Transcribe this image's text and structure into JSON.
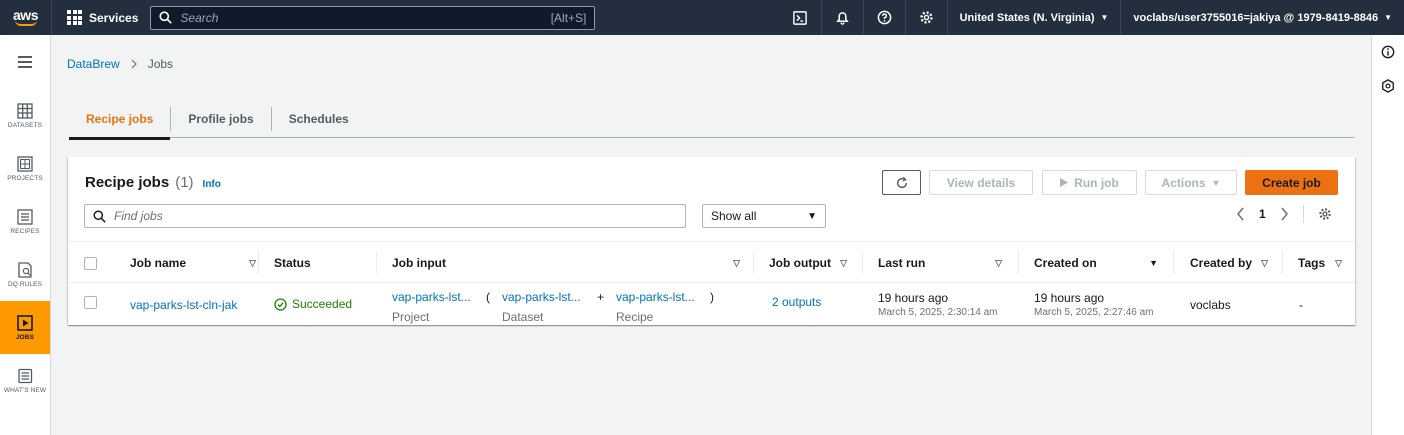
{
  "topnav": {
    "logo_text": "aws",
    "services_label": "Services",
    "search_placeholder": "Search",
    "search_shortcut": "[Alt+S]",
    "region": "United States (N. Virginia)",
    "account": "voclabs/user3755016=jakiya @ 1979-8419-8846"
  },
  "leftrail": {
    "items": [
      {
        "label": "DATASETS",
        "icon": "table-icon"
      },
      {
        "label": "PROJECTS",
        "icon": "grid-icon"
      },
      {
        "label": "RECIPES",
        "icon": "list-icon"
      },
      {
        "label": "DQ RULES",
        "icon": "dq-rules-icon"
      },
      {
        "label": "JOBS",
        "icon": "play-icon"
      },
      {
        "label": "WHAT'S NEW",
        "icon": "news-icon"
      }
    ]
  },
  "breadcrumb": {
    "root": "DataBrew",
    "current": "Jobs"
  },
  "tabs": [
    "Recipe jobs",
    "Profile jobs",
    "Schedules"
  ],
  "panel": {
    "title": "Recipe jobs",
    "count": "(1)",
    "info": "Info",
    "buttons": {
      "view": "View details",
      "run": "Run job",
      "actions": "Actions",
      "create": "Create job"
    },
    "search_placeholder": "Find jobs",
    "filter_value": "Show all",
    "page": "1"
  },
  "table": {
    "columns": [
      "Job name",
      "Status",
      "Job input",
      "Job output",
      "Last run",
      "Created on",
      "Created by",
      "Tags"
    ],
    "rows": [
      {
        "job_name": "vap-parks-lst-cln-jak",
        "status": "Succeeded",
        "input_project": "vap-parks-lst...",
        "input_project_label": "Project",
        "paren_open": "(",
        "input_dataset": "vap-parks-lst...",
        "input_dataset_label": "Dataset",
        "plus": "+",
        "input_recipe": "vap-parks-lst...",
        "input_recipe_label": "Recipe",
        "paren_close": ")",
        "output": "2 outputs",
        "last_run": "19 hours ago",
        "last_run_date": "March 5, 2025, 2:30:14 am",
        "created_on": "19 hours ago",
        "created_on_date": "March 5, 2025, 2:27:46 am",
        "created_by": "voclabs",
        "tags": "-"
      }
    ]
  },
  "colors": {
    "nav_bg": "#232f3e",
    "accent": "#ec7211",
    "link": "#0073bb",
    "success": "#1d8102"
  }
}
